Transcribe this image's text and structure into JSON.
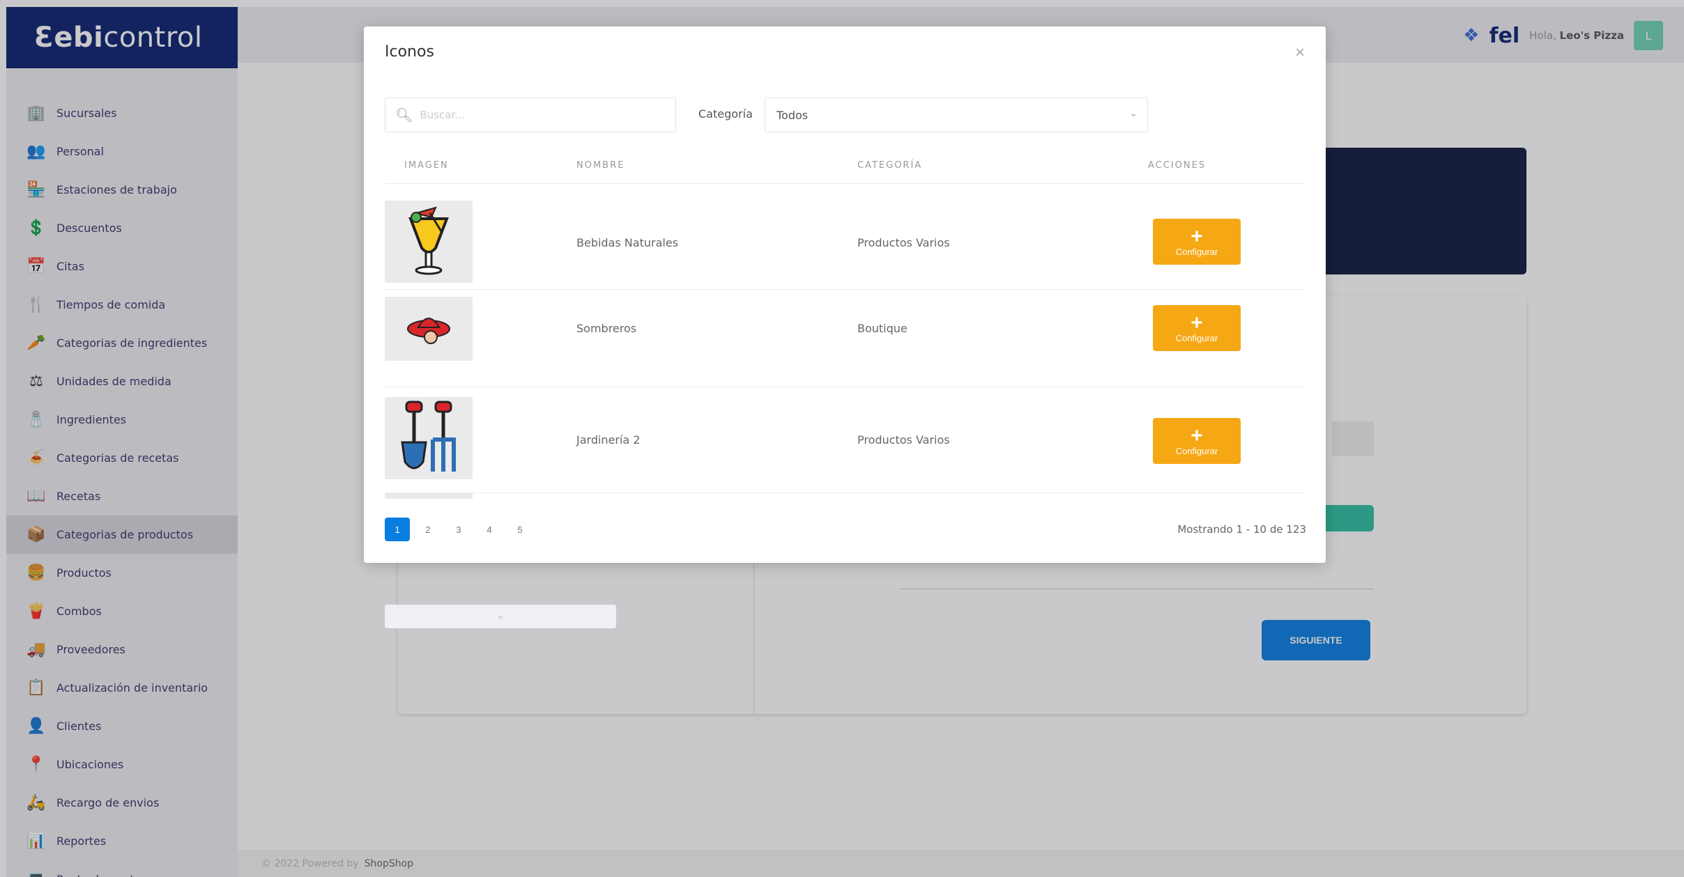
{
  "brand": {
    "bold": "ebi",
    "light": "control",
    "prefix": "Ɛ"
  },
  "sidebar": {
    "items": [
      {
        "label": "Sucursales",
        "icon": "building-icon",
        "glyph": "🏢"
      },
      {
        "label": "Personal",
        "icon": "people-icon",
        "glyph": "👥"
      },
      {
        "label": "Estaciones de trabajo",
        "icon": "workstation-icon",
        "glyph": "🏪"
      },
      {
        "label": "Descuentos",
        "icon": "discount-icon",
        "glyph": "💲"
      },
      {
        "label": "Citas",
        "icon": "calendar-icon",
        "glyph": "📅"
      },
      {
        "label": "Tiempos de comida",
        "icon": "meal-time-icon",
        "glyph": "🍴"
      },
      {
        "label": "Categorias de ingredientes",
        "icon": "ingredient-category-icon",
        "glyph": "🥕"
      },
      {
        "label": "Unidades de medida",
        "icon": "measure-icon",
        "glyph": "⚖"
      },
      {
        "label": "Ingredientes",
        "icon": "ingredients-icon",
        "glyph": "🧂"
      },
      {
        "label": "Categorias de recetas",
        "icon": "recipe-category-icon",
        "glyph": "🍝"
      },
      {
        "label": "Recetas",
        "icon": "recipes-icon",
        "glyph": "📖"
      },
      {
        "label": "Categorias de productos",
        "icon": "product-category-icon",
        "glyph": "📦",
        "active": true
      },
      {
        "label": "Productos",
        "icon": "products-icon",
        "glyph": "🍔"
      },
      {
        "label": "Combos",
        "icon": "combos-icon",
        "glyph": "🍟"
      },
      {
        "label": "Proveedores",
        "icon": "suppliers-icon",
        "glyph": "🚚"
      },
      {
        "label": "Actualización de inventario",
        "icon": "inventory-icon",
        "glyph": "📋"
      },
      {
        "label": "Clientes",
        "icon": "clients-icon",
        "glyph": "👤"
      },
      {
        "label": "Ubicaciones",
        "icon": "locations-icon",
        "glyph": "📍"
      },
      {
        "label": "Recargo de envios",
        "icon": "shipping-icon",
        "glyph": "🛵"
      },
      {
        "label": "Reportes",
        "icon": "reports-icon",
        "glyph": "📊"
      },
      {
        "label": "Punto de venta",
        "icon": "pos-icon",
        "glyph": "💻"
      }
    ]
  },
  "topbar": {
    "fel": "fel",
    "greeting": "Hola,",
    "user": "Leo's Pizza",
    "avatar": "L"
  },
  "main": {
    "next_label": "SIGUIENTE"
  },
  "footer": {
    "prefix": "© 2022 Powered by",
    "brand": "ShopShop"
  },
  "modal": {
    "title": "Iconos",
    "close": "×",
    "search_placeholder": "Buscar...",
    "category_label": "Categoría",
    "category_value": "Todos",
    "headers": {
      "image": "IMAGEN",
      "name": "NOMBRE",
      "category": "CATEGORÍA",
      "actions": "ACCIONES"
    },
    "rows": [
      {
        "name": "Bebidas Naturales",
        "category": "Productos Varios",
        "icon": "cocktail-icon",
        "button": "Configurar"
      },
      {
        "name": "Sombreros",
        "category": "Boutique",
        "icon": "hat-icon",
        "button": "Configurar"
      },
      {
        "name": "Jardinería 2",
        "category": "Productos Varios",
        "icon": "garden-tools-icon",
        "button": "Configurar"
      }
    ],
    "pagination": {
      "first": "«",
      "prev": "‹",
      "next": "›",
      "last": "»",
      "pages": [
        "1",
        "2",
        "3",
        "4",
        "5"
      ],
      "current": "1",
      "showing": "Mostrando 1 - 10 de 123"
    }
  },
  "colors": {
    "brand": "#0b2270",
    "accent": "#f6a714",
    "primary": "#0a7ee0",
    "teal": "#2fbfa0"
  }
}
